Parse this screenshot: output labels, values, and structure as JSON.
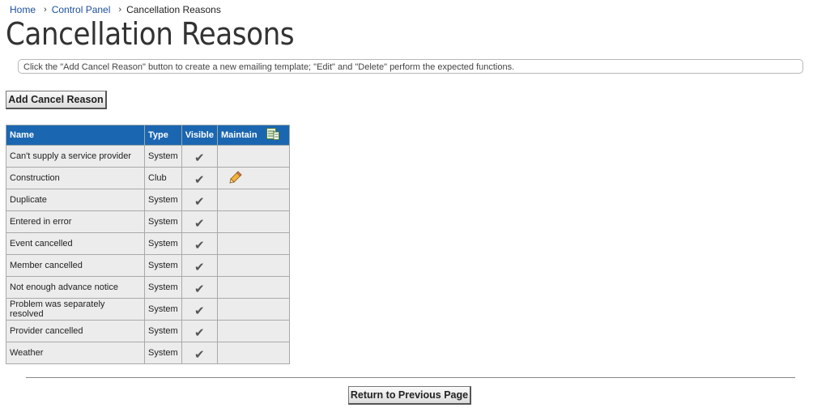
{
  "breadcrumb": {
    "home": "Home",
    "control_panel": "Control Panel",
    "current": "Cancellation Reasons"
  },
  "page_title": "Cancellation Reasons",
  "info_text": "Click the \"Add Cancel Reason\" button to create a new emailing template; \"Edit\" and \"Delete\" perform the expected functions.",
  "add_button_label": "Add Cancel Reason",
  "table": {
    "headers": {
      "name": "Name",
      "type": "Type",
      "visible": "Visible",
      "maintain": "Maintain"
    },
    "maintain_header_icon": "export-spreadsheet-icon",
    "check_icon": "checkmark-icon",
    "edit_icon": "pencil-icon",
    "rows": [
      {
        "name": "Can't supply a service provider",
        "type": "System",
        "visible": true,
        "editable": false
      },
      {
        "name": "Construction",
        "type": "Club",
        "visible": true,
        "editable": true
      },
      {
        "name": "Duplicate",
        "type": "System",
        "visible": true,
        "editable": false
      },
      {
        "name": "Entered in error",
        "type": "System",
        "visible": true,
        "editable": false
      },
      {
        "name": "Event cancelled",
        "type": "System",
        "visible": true,
        "editable": false
      },
      {
        "name": "Member cancelled",
        "type": "System",
        "visible": true,
        "editable": false
      },
      {
        "name": "Not enough advance notice",
        "type": "System",
        "visible": true,
        "editable": false
      },
      {
        "name": "Problem was separately resolved",
        "type": "System",
        "visible": true,
        "editable": false
      },
      {
        "name": "Provider cancelled",
        "type": "System",
        "visible": true,
        "editable": false
      },
      {
        "name": "Weather",
        "type": "System",
        "visible": true,
        "editable": false
      }
    ]
  },
  "return_button_label": "Return to Previous Page",
  "colors": {
    "header_bg": "#1b66b1",
    "cell_bg": "#ececec",
    "link": "#1a4f9c"
  }
}
